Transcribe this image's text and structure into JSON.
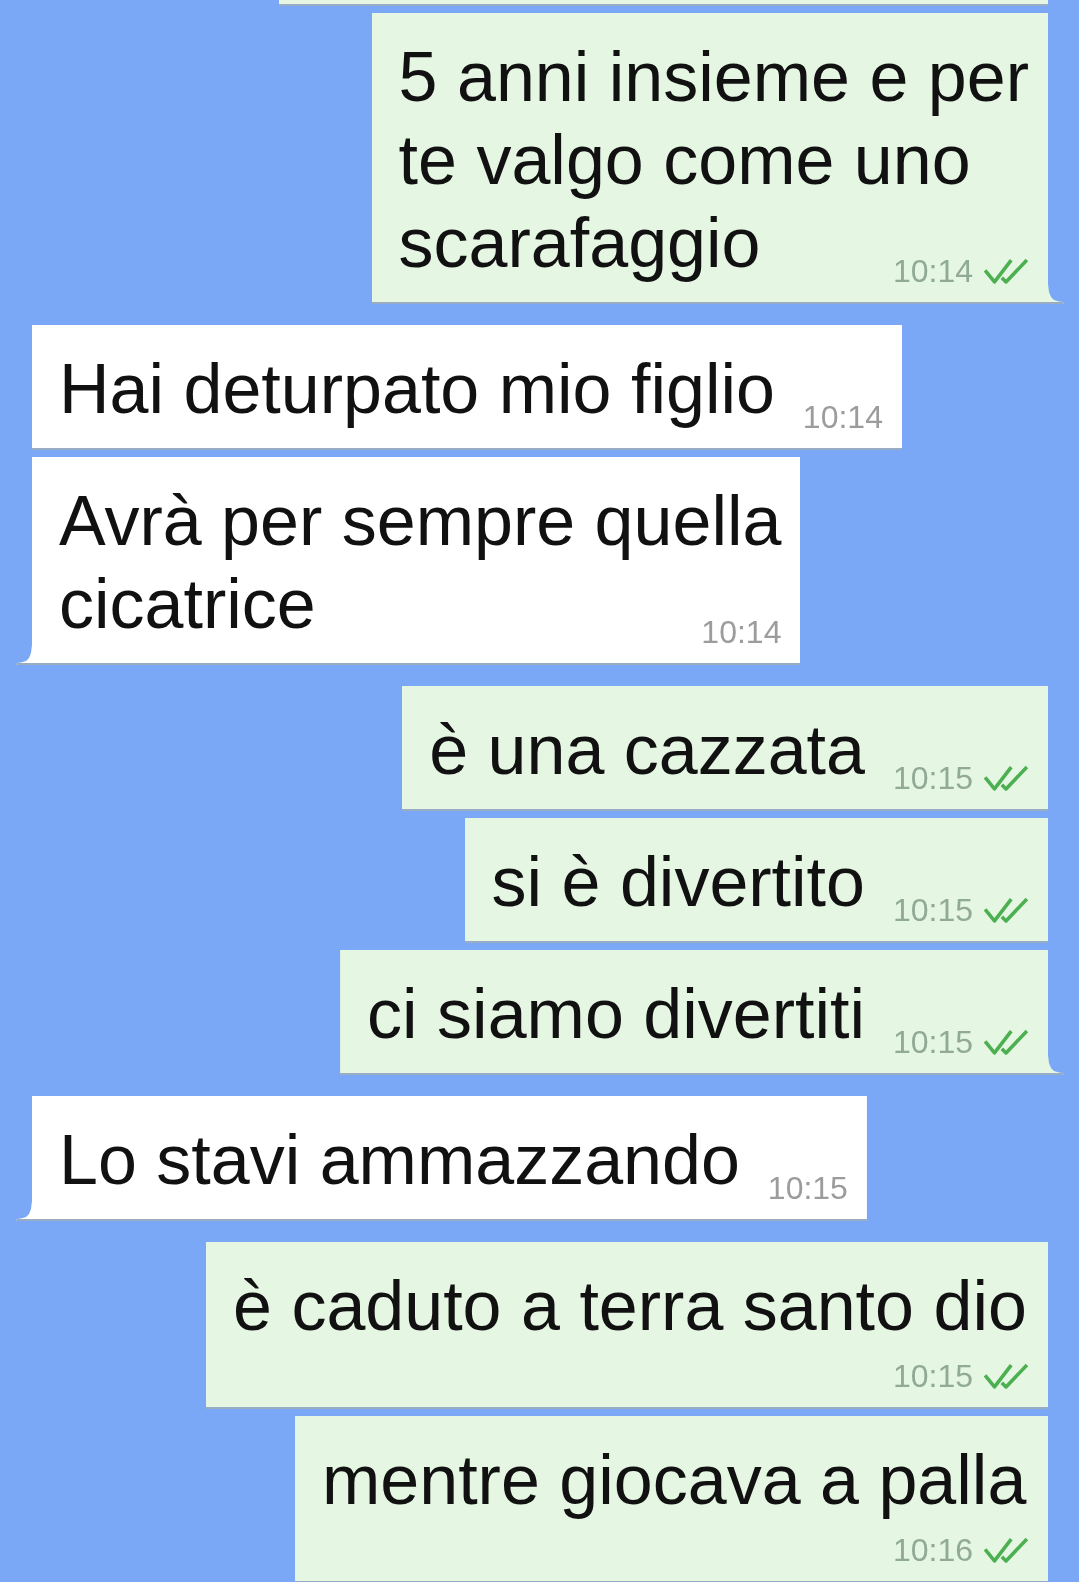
{
  "partial_bubble_above": {
    "kind": "sent"
  },
  "messages": [
    {
      "kind": "sent",
      "lines": [
        "5 anni insieme e per",
        "te valgo come uno",
        "scarafaggio"
      ],
      "time": "10:14",
      "read": true,
      "tail": true
    },
    {
      "kind": "received",
      "lines": [
        "Hai deturpato mio figlio"
      ],
      "time": "10:14",
      "tail": false
    },
    {
      "kind": "received",
      "lines": [
        "Avrà per sempre quella",
        "cicatrice"
      ],
      "time": "10:14",
      "tail": true
    },
    {
      "kind": "sent",
      "lines": [
        "è una cazzata"
      ],
      "time": "10:15",
      "read": true,
      "tail": false
    },
    {
      "kind": "sent",
      "lines": [
        "si è divertito"
      ],
      "time": "10:15",
      "read": true,
      "tail": false
    },
    {
      "kind": "sent",
      "lines": [
        "ci siamo divertiti"
      ],
      "time": "10:15",
      "read": true,
      "tail": true
    },
    {
      "kind": "received",
      "lines": [
        "Lo stavi ammazzando"
      ],
      "time": "10:15",
      "tail": true
    },
    {
      "kind": "sent",
      "lines": [
        "è caduto a terra santo dio"
      ],
      "time": "10:15",
      "read": true,
      "tail": false
    },
    {
      "kind": "sent",
      "lines": [
        "mentre giocava a palla"
      ],
      "time": "10:16",
      "read": true,
      "tail": false
    }
  ]
}
